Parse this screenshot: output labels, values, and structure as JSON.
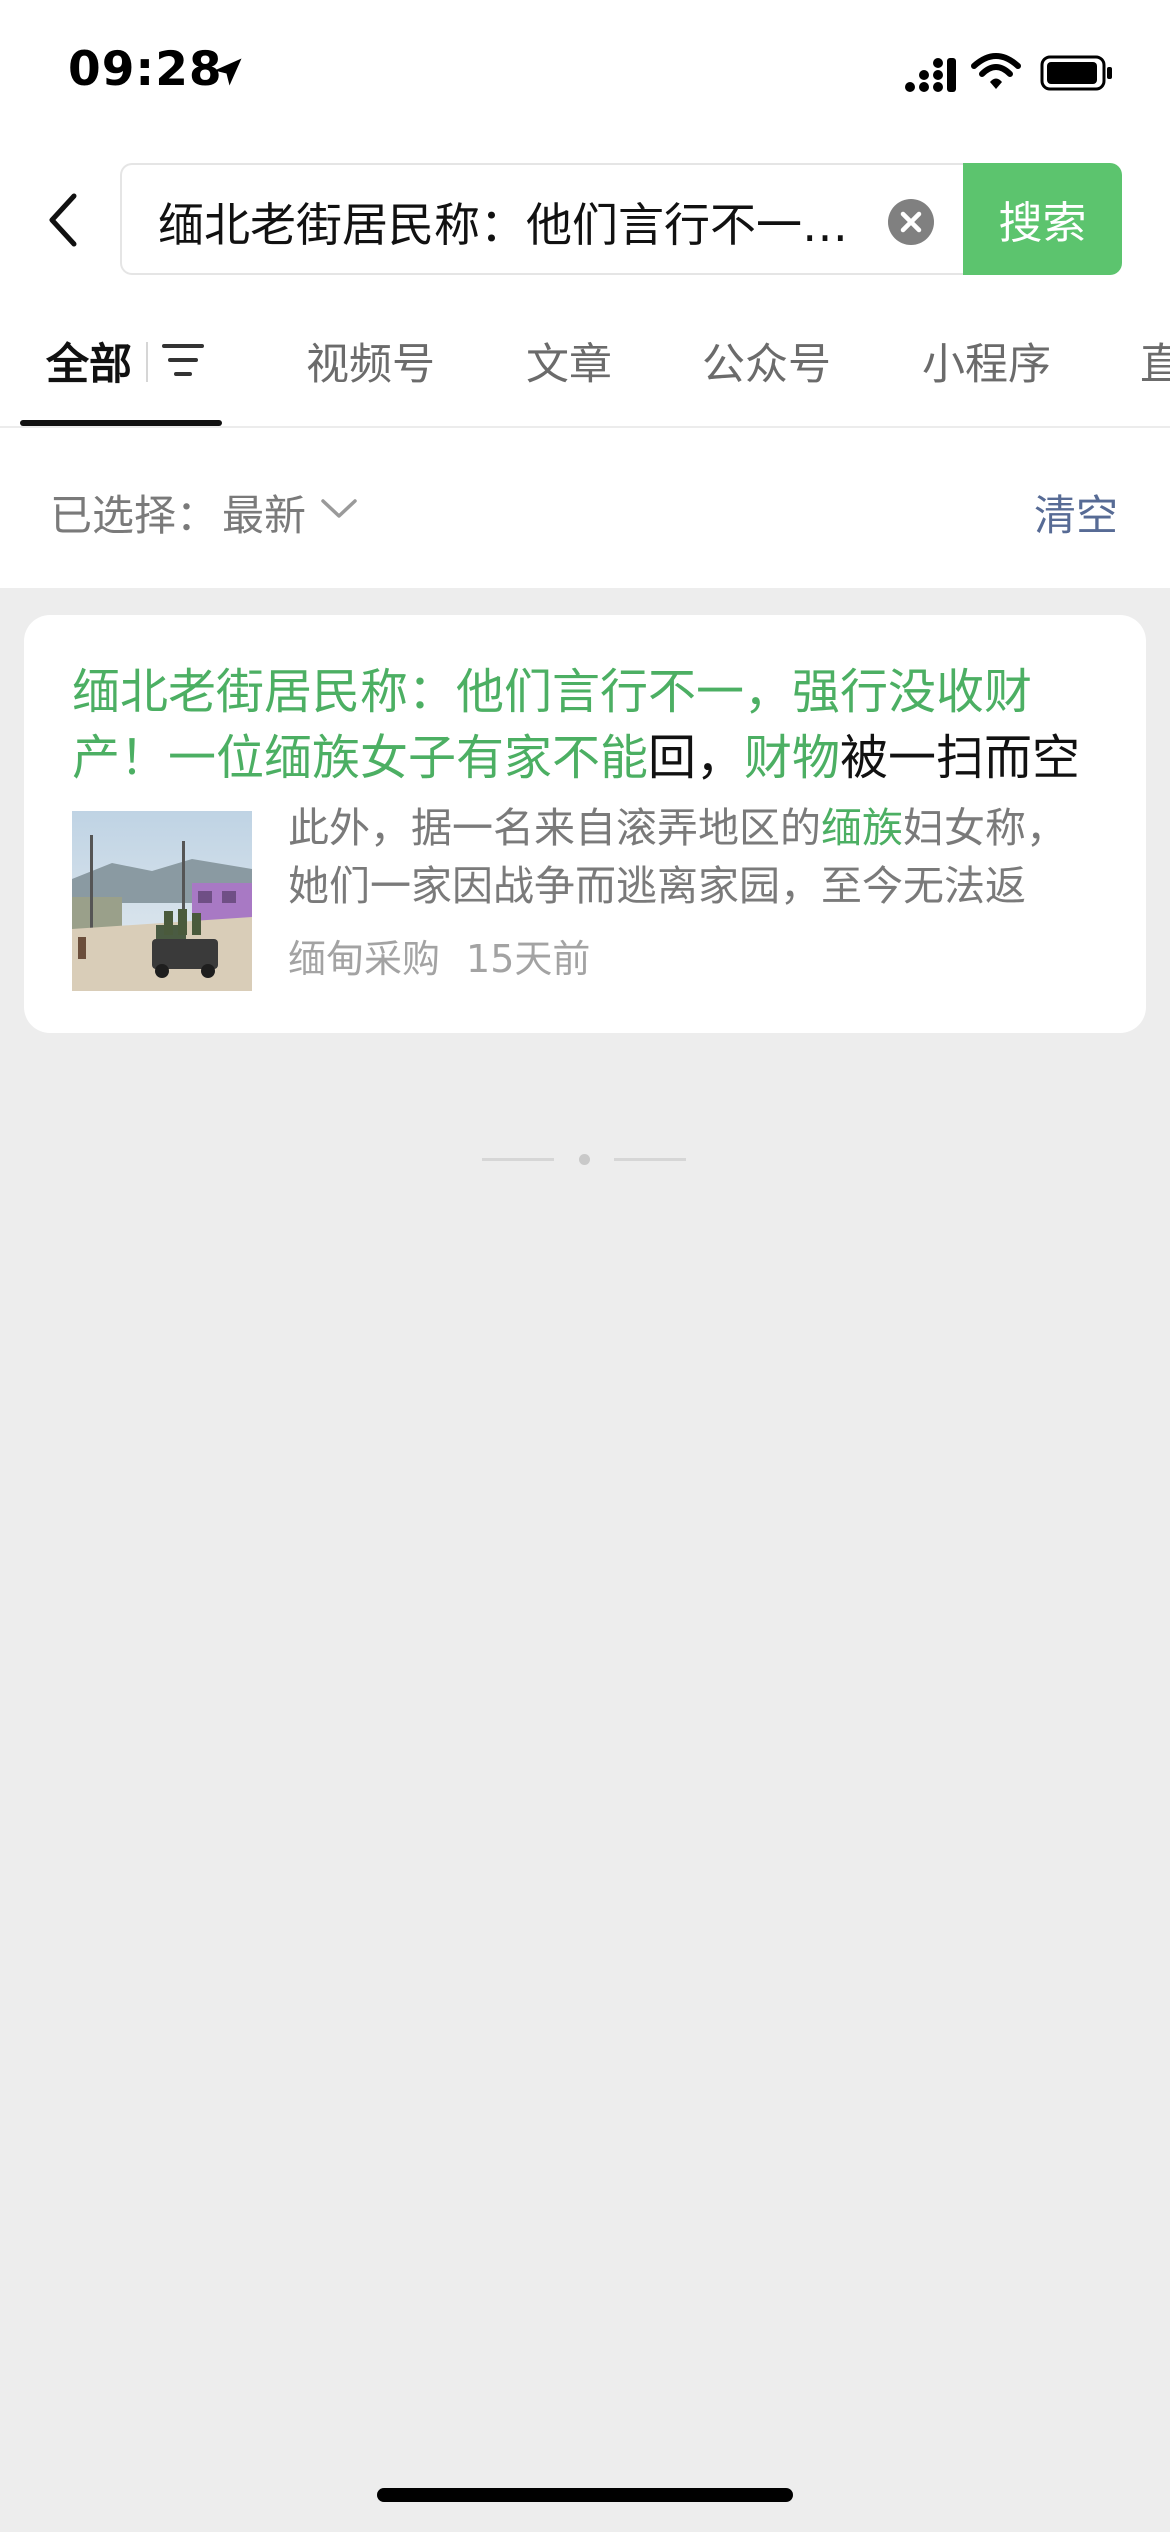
{
  "status_bar": {
    "time": "09:28"
  },
  "search": {
    "query": "缅北老街居民称：他们言行不一，强行没收财产！一位缅族女子有家不能回，财物被一扫而空",
    "button_label": "搜索"
  },
  "tabs": [
    {
      "label": "全部",
      "active": true
    },
    {
      "label": "视频号"
    },
    {
      "label": "文章"
    },
    {
      "label": "公众号"
    },
    {
      "label": "小程序"
    },
    {
      "label": "直"
    }
  ],
  "filter": {
    "label": "已选择：",
    "value": "最新",
    "clear_label": "清空"
  },
  "result": {
    "title_parts": [
      {
        "text": "缅北老街居民称：他们言行不一，强行没收财产！一位缅族女子有家不能",
        "highlight": true
      },
      {
        "text": "回，",
        "highlight": false
      },
      {
        "text": "财物",
        "highlight": true
      },
      {
        "text": "被一扫而空",
        "highlight": false
      }
    ],
    "desc_parts": [
      {
        "text": "此外，据一名来自滚弄地区的",
        "highlight": false
      },
      {
        "text": "缅族",
        "highlight": true
      },
      {
        "text": "妇女称，她们一家因战争而逃离家园，至今无法返回……",
        "highlight": false
      }
    ],
    "source": "缅甸采购",
    "time": "15天前"
  },
  "colors": {
    "accent": "#5cc46e",
    "highlight": "#4caf63",
    "link": "#576b95"
  }
}
